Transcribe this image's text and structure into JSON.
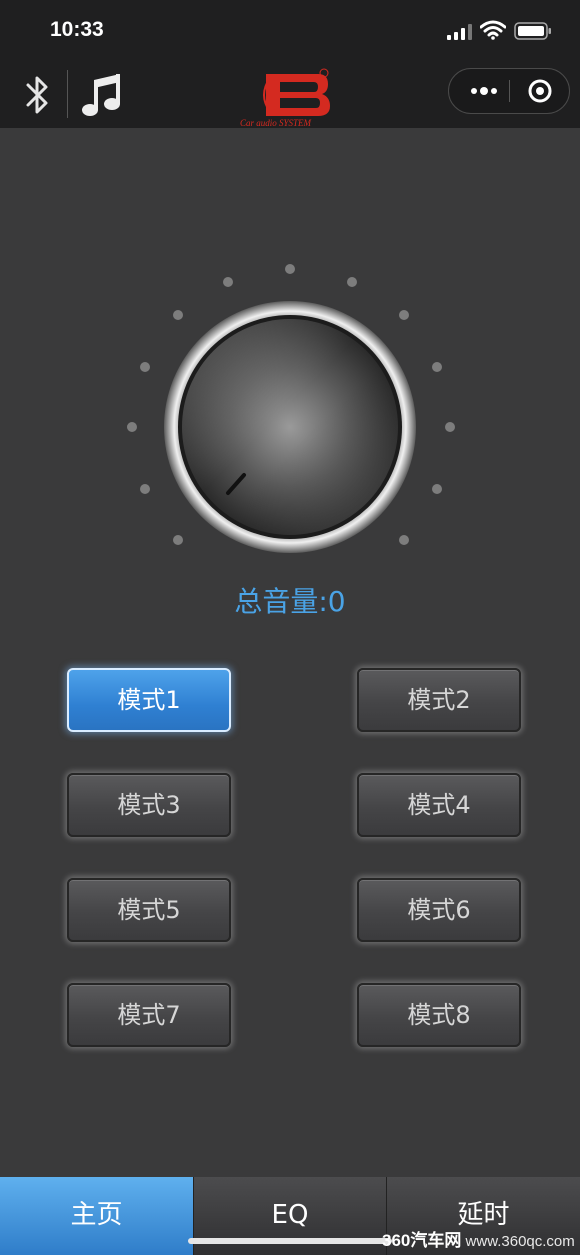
{
  "status_bar": {
    "time": "10:33"
  },
  "header": {
    "logo_text": "Car audio SYSTEM",
    "logo_brand": "B"
  },
  "volume": {
    "label": "总音量:0",
    "value": 0
  },
  "modes": [
    {
      "label": "模式1",
      "active": true
    },
    {
      "label": "模式2",
      "active": false
    },
    {
      "label": "模式3",
      "active": false
    },
    {
      "label": "模式4",
      "active": false
    },
    {
      "label": "模式5",
      "active": false
    },
    {
      "label": "模式6",
      "active": false
    },
    {
      "label": "模式7",
      "active": false
    },
    {
      "label": "模式8",
      "active": false
    }
  ],
  "tabs": [
    {
      "label": "主页",
      "active": true
    },
    {
      "label": "EQ",
      "active": false
    },
    {
      "label": "延时",
      "active": false
    }
  ],
  "watermark": {
    "brand": "360汽车网",
    "url": "www.360qc.com"
  },
  "colors": {
    "accent": "#4aa3e6",
    "logo_red": "#d42a20",
    "background": "#3a3a3b"
  }
}
